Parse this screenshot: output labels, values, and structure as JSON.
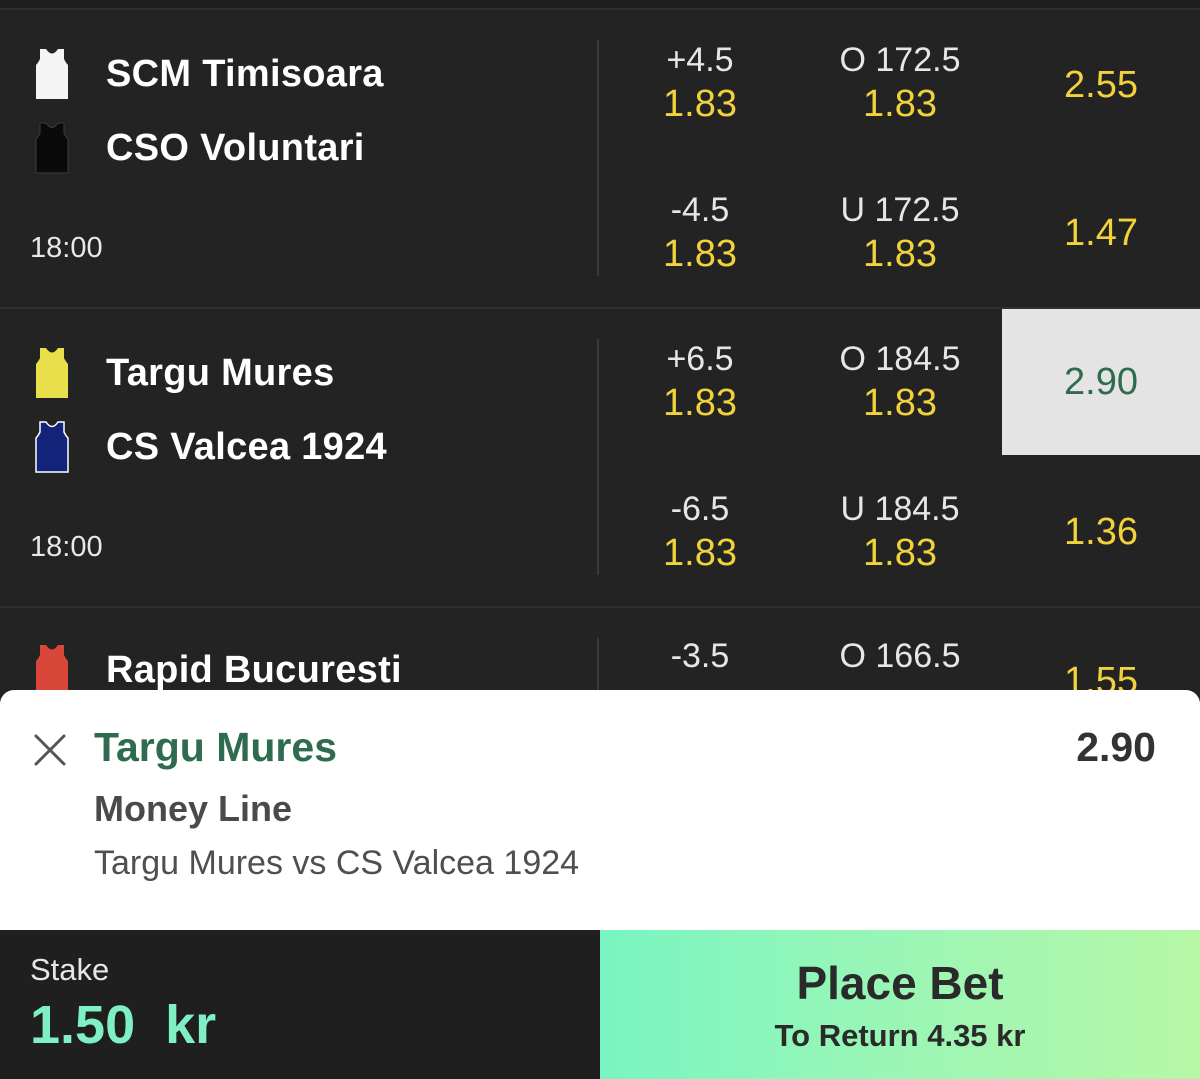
{
  "matches": [
    {
      "home": {
        "name": "SCM Timisoara",
        "jersey_color": "#f4f4f4"
      },
      "away": {
        "name": "CSO Voluntari",
        "jersey_color": "#0a0a0a"
      },
      "time": "18:00",
      "handicap": [
        {
          "line": "+4.5",
          "odds": "1.83"
        },
        {
          "line": "-4.5",
          "odds": "1.83"
        }
      ],
      "total": [
        {
          "line": "O 172.5",
          "odds": "1.83"
        },
        {
          "line": "U 172.5",
          "odds": "1.83"
        }
      ],
      "moneyline": [
        "2.55",
        "1.47"
      ]
    },
    {
      "home": {
        "name": "Targu Mures",
        "jersey_color": "#e8df4a"
      },
      "away": {
        "name": "CS Valcea 1924",
        "jersey_color": "#14237a"
      },
      "time": "18:00",
      "handicap": [
        {
          "line": "+6.5",
          "odds": "1.83"
        },
        {
          "line": "-6.5",
          "odds": "1.83"
        }
      ],
      "total": [
        {
          "line": "O 184.5",
          "odds": "1.83"
        },
        {
          "line": "U 184.5",
          "odds": "1.83"
        }
      ],
      "moneyline": [
        "2.90",
        "1.36"
      ],
      "selected_moneyline": 0
    },
    {
      "home": {
        "name": "Rapid Bucuresti",
        "jersey_color": "#d9473b"
      },
      "handicap": [
        {
          "line": "-3.5"
        }
      ],
      "total": [
        {
          "line": "O 166.5"
        }
      ],
      "moneyline": [
        "1.55"
      ]
    }
  ],
  "bet_slip": {
    "selection": "Targu Mures",
    "odds": "2.90",
    "market": "Money Line",
    "event": "Targu Mures vs CS Valcea 1924"
  },
  "stake": {
    "label": "Stake",
    "amount": "1.50  kr"
  },
  "place_bet": {
    "label": "Place Bet",
    "to_return": "To Return 4.35 kr"
  },
  "colors": {
    "odds": "#f2d23b",
    "selected_bg": "#e4e4e4",
    "accent_green": "#2e6b4f",
    "stake_green": "#7ef0c4"
  },
  "icons": {
    "close": "close-icon",
    "jersey": "jersey-icon"
  }
}
